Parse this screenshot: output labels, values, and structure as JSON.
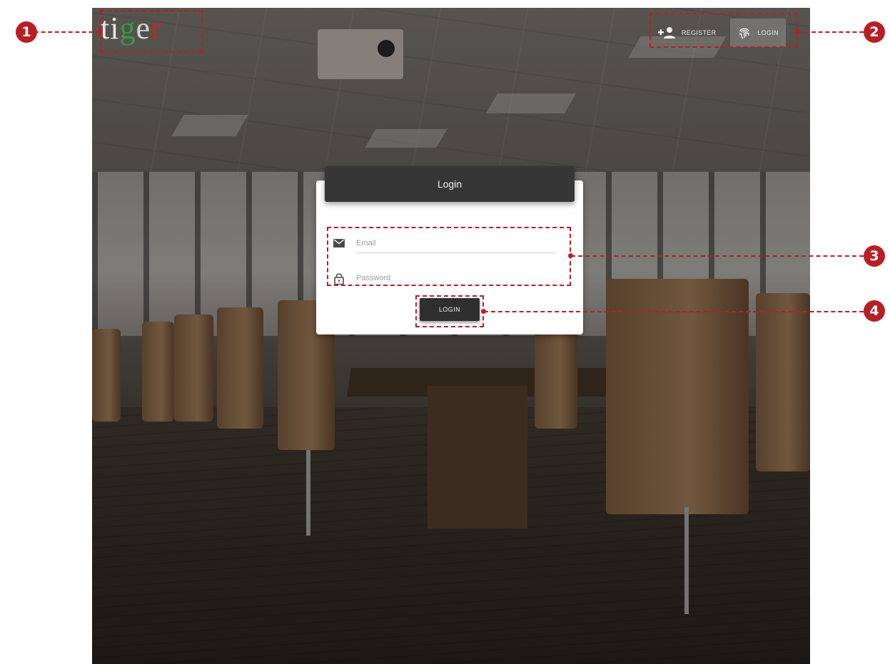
{
  "logo": {
    "parts": [
      "ti",
      "g",
      "e",
      "r"
    ]
  },
  "nav": {
    "register_label": "REGISTER",
    "login_label": "LOGIN",
    "icons": [
      "person-add-icon",
      "fingerprint-icon"
    ]
  },
  "login_card": {
    "title": "Login",
    "email_placeholder": "Email",
    "password_placeholder": "Password",
    "submit_label": "LOGIN",
    "icons": [
      "mail-icon",
      "lock-icon"
    ]
  },
  "annotations": {
    "markers": [
      "1",
      "2",
      "3",
      "4"
    ],
    "color": "#b81f25"
  },
  "colors": {
    "card_header": "#363636",
    "login_button": "#2f2f2f",
    "logo_green": "#3a9a45",
    "logo_red": "#c1272d"
  }
}
